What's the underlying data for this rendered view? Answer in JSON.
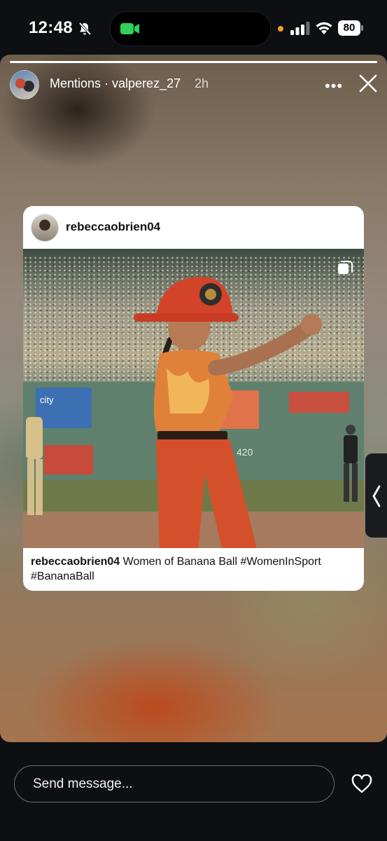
{
  "status_bar": {
    "time": "12:48",
    "battery": "80",
    "icons": [
      "bell-slash-icon",
      "video-camera-icon",
      "cellular-signal-icon",
      "wifi-icon",
      "battery-icon"
    ]
  },
  "story": {
    "progress": 1.0,
    "header": {
      "title": "Mentions · valperez_27",
      "time": "2h"
    },
    "post": {
      "username": "rebeccaobrien04",
      "caption_user": "rebeccaobrien04",
      "caption_text": " Women of Banana Ball #WomenInSport #BananaBall",
      "wall_signs": [
        "city",
        "",
        "",
        "",
        "420"
      ]
    }
  },
  "composer": {
    "placeholder": "Send message..."
  },
  "colors": {
    "background": "#0d0f13",
    "card": "#ffffff",
    "accent_orange": "#f0a030",
    "camera_green": "#30d158"
  }
}
